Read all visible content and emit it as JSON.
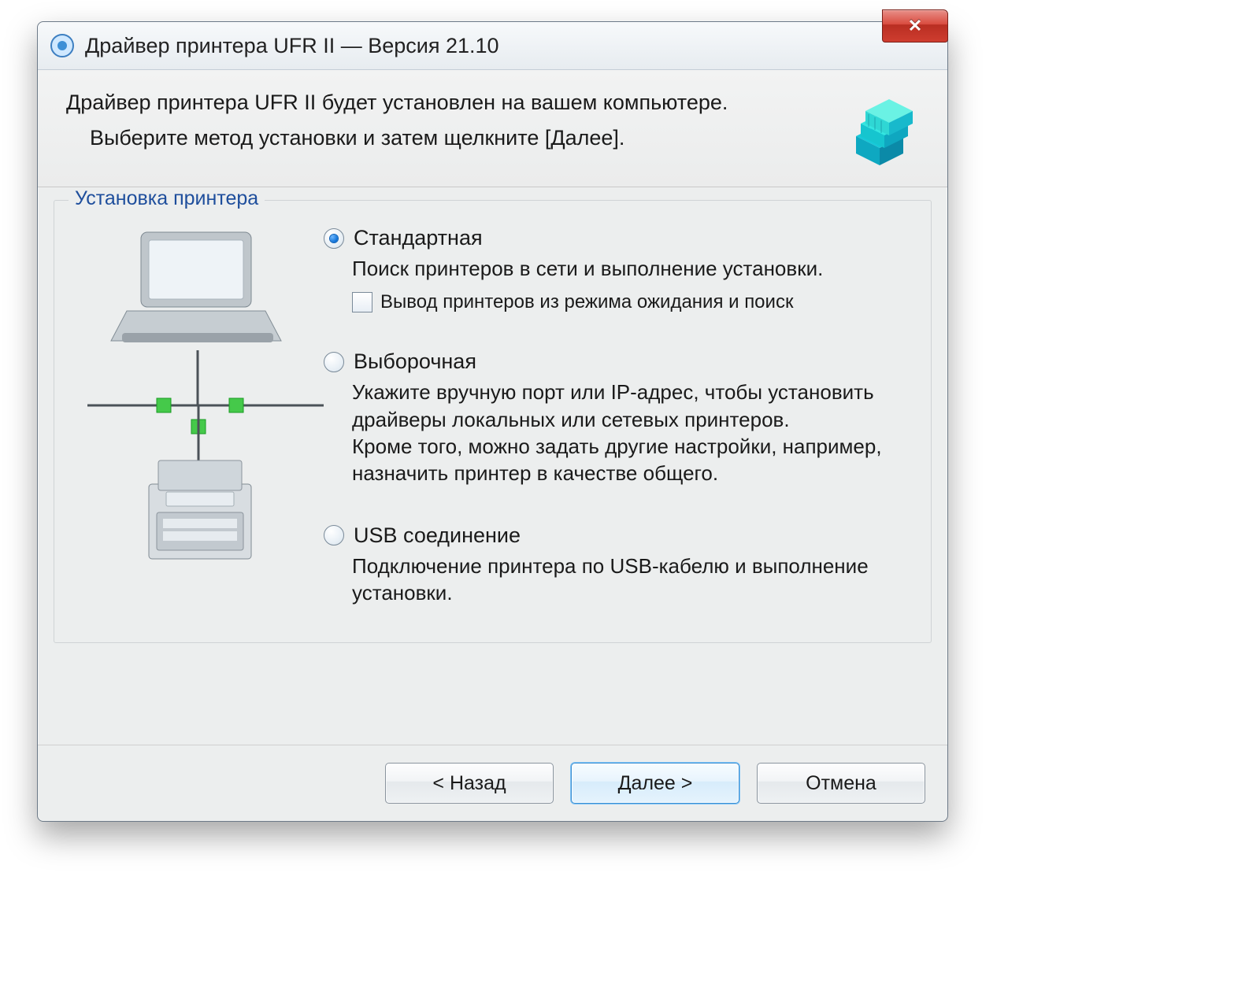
{
  "window": {
    "title": "Драйвер принтера UFR II — Версия 21.10"
  },
  "header": {
    "line1": "Драйвер принтера UFR II будет установлен на вашем компьютере.",
    "line2": "Выберите метод установки и затем щелкните [Далее]."
  },
  "group": {
    "legend": "Установка принтера",
    "options": [
      {
        "key": "standard",
        "title": "Стандартная",
        "desc": "Поиск принтеров в сети и выполнение установки.",
        "checked": true,
        "checkbox_label": "Вывод принтеров из режима ожидания и поиск"
      },
      {
        "key": "custom",
        "title": "Выборочная",
        "desc": "Укажите вручную порт или IP-адрес, чтобы установить драйверы локальных или сетевых принтеров.\nКроме того, можно задать другие настройки, например, назначить принтер в качестве общего.",
        "checked": false
      },
      {
        "key": "usb",
        "title": "USB соединение",
        "desc": "Подключение принтера по USB-кабелю и выполнение установки.",
        "checked": false
      }
    ]
  },
  "footer": {
    "back": "< Назад",
    "next": "Далее >",
    "cancel": "Отмена"
  }
}
